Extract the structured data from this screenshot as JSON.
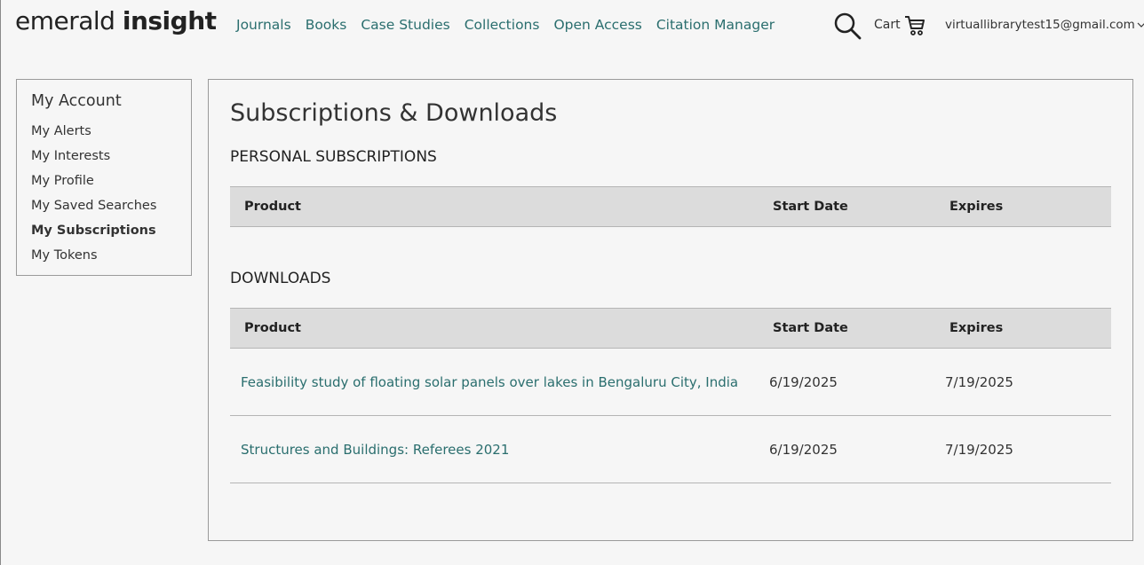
{
  "brand": {
    "logo_light": "emerald ",
    "logo_bold": "insight"
  },
  "nav": [
    "Journals",
    "Books",
    "Case Studies",
    "Collections",
    "Open Access",
    "Citation Manager"
  ],
  "header": {
    "cart_label": "Cart",
    "user_email": "virtuallibrarytest15@gmail.com"
  },
  "sidebar": {
    "title": "My Account",
    "items": [
      {
        "label": "My Alerts",
        "active": false
      },
      {
        "label": "My Interests",
        "active": false
      },
      {
        "label": "My Profile",
        "active": false
      },
      {
        "label": "My Saved Searches",
        "active": false
      },
      {
        "label": "My Subscriptions",
        "active": true
      },
      {
        "label": "My Tokens",
        "active": false
      }
    ]
  },
  "main": {
    "title": "Subscriptions & Downloads",
    "personal": {
      "heading": "PERSONAL SUBSCRIPTIONS",
      "columns": [
        "Product",
        "Start Date",
        "Expires"
      ]
    },
    "downloads": {
      "heading": "DOWNLOADS",
      "columns": [
        "Product",
        "Start Date",
        "Expires"
      ],
      "rows": [
        {
          "product": "Feasibility study of floating solar panels over lakes in Bengaluru City, India",
          "start": "6/19/2025",
          "expires": "7/19/2025"
        },
        {
          "product": "Structures and Buildings: Referees 2021",
          "start": "6/19/2025",
          "expires": "7/19/2025"
        }
      ]
    }
  },
  "colors": {
    "link": "#2a6e6e",
    "table_header_bg": "#dcdcdc",
    "background": "#f6f6f6"
  },
  "icons": [
    "search-icon",
    "cart-icon",
    "chevron-down-icon"
  ]
}
